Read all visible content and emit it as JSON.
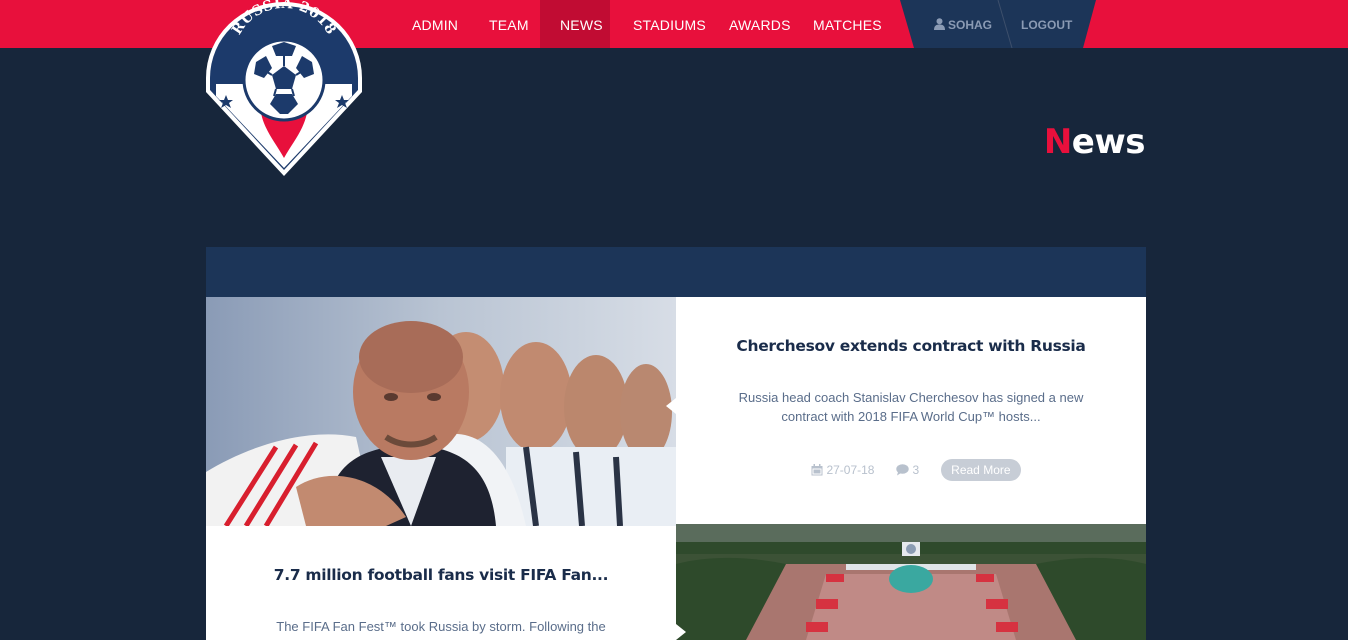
{
  "nav": {
    "items": [
      {
        "label": "ADMIN",
        "active": false
      },
      {
        "label": "TEAM",
        "active": false
      },
      {
        "label": "NEWS",
        "active": true
      },
      {
        "label": "STADIUMS",
        "active": false
      },
      {
        "label": "AWARDS",
        "active": false
      },
      {
        "label": "MATCHES",
        "active": false
      }
    ],
    "user": "SOHAG",
    "logout": "LOGOUT"
  },
  "logo": {
    "text": "RUSSIA 2018"
  },
  "page": {
    "title_first": "N",
    "title_rest": "ews"
  },
  "articles": [
    {
      "title": "Cherchesov extends contract with Russia",
      "excerpt": "Russia head coach Stanislav Cherchesov has signed a new contract with 2018 FIFA World Cup™ hosts...",
      "date": "27-07-18",
      "comments": "3",
      "read_more": "Read More"
    },
    {
      "title": "7.7 million football fans visit FIFA Fan...",
      "excerpt": "The FIFA Fan Fest™ took Russia by storm. Following the"
    }
  ],
  "colors": {
    "brand_red": "#e8103c",
    "background": "#17263b",
    "panel_blue": "#1c3558"
  }
}
